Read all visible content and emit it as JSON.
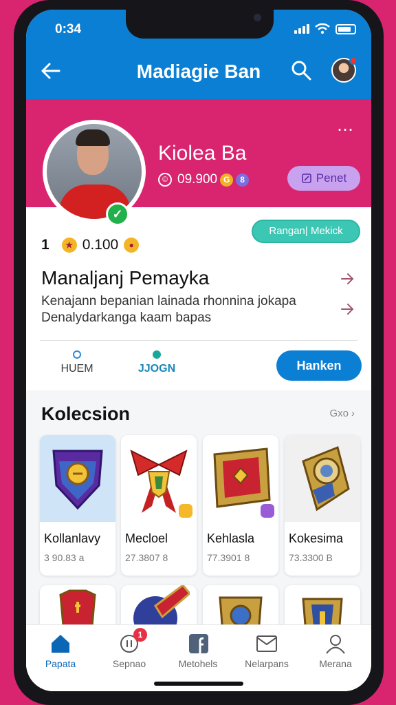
{
  "status_bar": {
    "time": "0:34"
  },
  "header": {
    "title": "Madiagie Ban"
  },
  "profile": {
    "name": "Kiolea Ba",
    "coins": "09.900",
    "chip1": "G",
    "chip2": "8",
    "edit_label": "Penet",
    "tag_label": "Rangan| Mekick",
    "rank": "1",
    "points": "0.100",
    "subtitle": "Manaljanj Pemayka",
    "desc_line1": "Kenajann bepanian lainada rhonnina jokapa",
    "desc_line2": "Denalydarkanga kaam bapas"
  },
  "tabs": [
    {
      "label": "HUEM"
    },
    {
      "label": "JJOGN"
    }
  ],
  "follow_label": "Hanken",
  "collection": {
    "title": "Kolecsion",
    "see_all": "Gxo",
    "items": [
      {
        "name": "Kollanlavy",
        "value": "3 90.83 a"
      },
      {
        "name": "Mecloel",
        "value": "27.3807 8"
      },
      {
        "name": "Kehlasla",
        "value": "77.3901 8"
      },
      {
        "name": "Kokesima",
        "value": "73.3300 B"
      }
    ]
  },
  "nav": {
    "badge": "1",
    "items": [
      {
        "label": "Papata"
      },
      {
        "label": "Sepnao"
      },
      {
        "label": "Metohels"
      },
      {
        "label": "Nelarpans"
      },
      {
        "label": "Merana"
      }
    ]
  },
  "colors": {
    "primary_blue": "#0b7fd4",
    "header_pink": "#d9246f",
    "teal": "#3cc7b4",
    "lavender": "#c8a2ee"
  }
}
